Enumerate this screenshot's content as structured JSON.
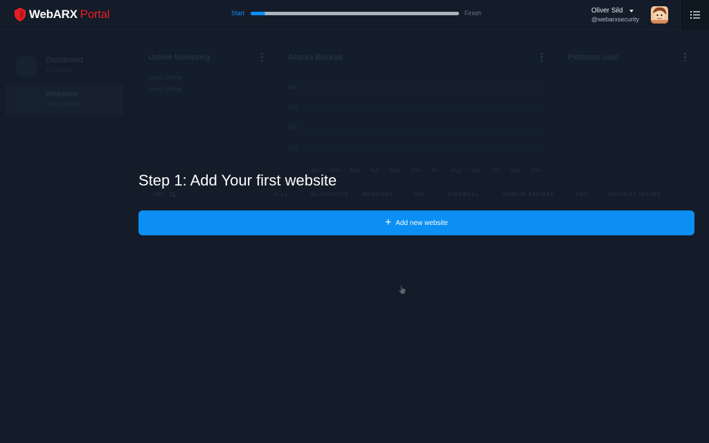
{
  "header": {
    "brand": "WebARX",
    "brand_suffix": "Portal",
    "progress": {
      "start_label": "Start",
      "finish_label": "Finish",
      "value_fraction": 0.07
    },
    "user": {
      "name": "Oliver Sild",
      "handle": "@webarxsecurity"
    }
  },
  "sidebar": {
    "items": [
      {
        "title": "Dashboard",
        "subtitle": "4 updates",
        "icon": "calendar-icon"
      },
      {
        "title": "Websites",
        "subtitle": "364 domains",
        "icon": "browser-icon"
      }
    ]
  },
  "cards": {
    "uptime": {
      "title": "Uptime Monitoring",
      "rows": [
        "Sites Online",
        "Sites Offline"
      ]
    },
    "attacks": {
      "title": "Attacks Blocked",
      "y_ticks": [
        "400",
        "300",
        "200",
        "100"
      ],
      "months": [
        "Jan",
        "Feb",
        "Mar",
        "Apr",
        "May",
        "Jun",
        "Jul",
        "Aug",
        "Sep",
        "Oct",
        "Nov",
        "Dec"
      ]
    },
    "platforms": {
      "title": "Platforms used"
    }
  },
  "table": {
    "columns": [
      "URL",
      "SLAs",
      "BLACKLISTS",
      "MENTIONS",
      "SSL",
      "FIREWALL",
      "DOMAIN EXPIRES",
      "CMS",
      "SECURITY ISSUES"
    ]
  },
  "tour": {
    "step_title": "Step 1: Add Your first website",
    "button_label": "Add new website"
  },
  "colors": {
    "accent": "#0b8ff2",
    "brand_red": "#e31e24",
    "background": "#131c28"
  }
}
